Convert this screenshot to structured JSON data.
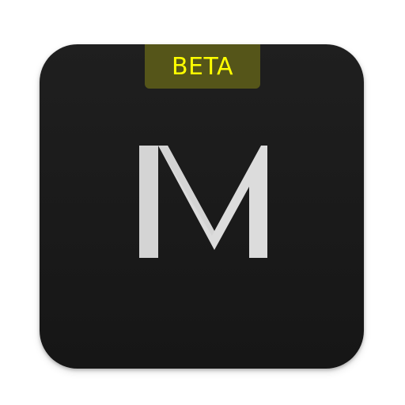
{
  "icon": {
    "name": "m-logo-icon",
    "background_color": "#1b1b1b",
    "letter_color": "#dddddd"
  },
  "badge": {
    "label": "BETA",
    "text_color": "#ffff00",
    "background_color": "#555519"
  }
}
